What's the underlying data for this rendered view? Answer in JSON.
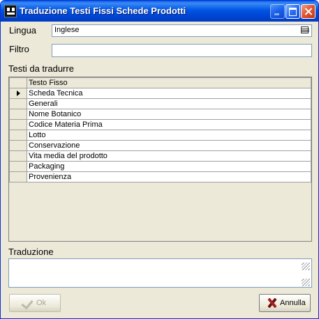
{
  "window": {
    "title": "Traduzione Testi Fissi Schede Prodotti",
    "icons": [
      "app-icon",
      "minimize-icon",
      "maximize-icon",
      "close-icon"
    ]
  },
  "form": {
    "lingua_label": "Lingua",
    "lingua_value": "Inglese",
    "filtro_label": "Filtro",
    "filtro_value": "",
    "testi_label": "Testi da tradurre",
    "traduzione_label": "Traduzione",
    "traduzione_value": ""
  },
  "grid": {
    "header": "Testo Fisso",
    "rows": [
      "Scheda Tecnica",
      "Generali",
      "Nome Botanico",
      "Codice Materia Prima",
      "Lotto",
      "Conservazione",
      "Vita media del prodotto",
      "Packaging",
      "Provenienza"
    ],
    "selected_row": 0
  },
  "buttons": {
    "ok": "Ok",
    "annulla": "Annulla"
  }
}
